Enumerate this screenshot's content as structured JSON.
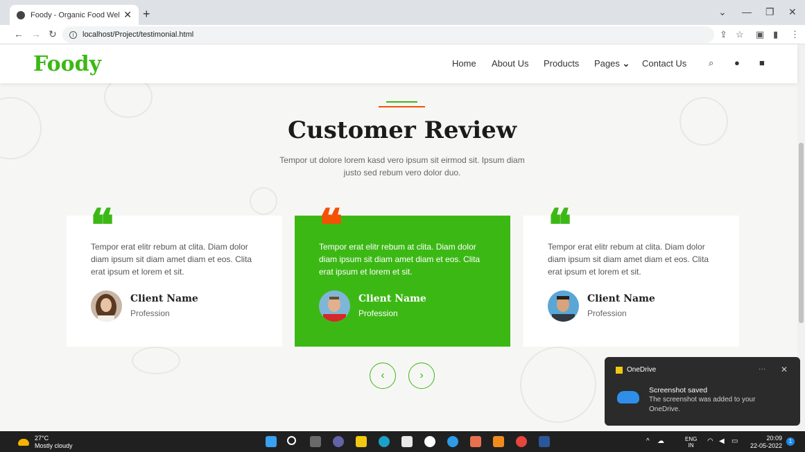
{
  "browser": {
    "tab_title": "Foody - Organic Food Website T",
    "url": "localhost/Project/testimonial.html",
    "new_tab": "+",
    "tab_close": "✕"
  },
  "site": {
    "logo": "Foody",
    "nav": [
      "Home",
      "About Us",
      "Products",
      "Pages",
      "Contact Us"
    ],
    "pages_caret": "⌄"
  },
  "section": {
    "title": "Customer Review",
    "subtitle": "Tempor ut dolore lorem kasd vero ipsum sit eirmod sit. Ipsum diam justo sed rebum vero dolor duo."
  },
  "testimonials": [
    {
      "text": "Tempor erat elitr rebum at clita. Diam dolor diam ipsum sit diam amet diam et eos. Clita erat ipsum et lorem et sit.",
      "name": "Client Name",
      "profession": "Profession"
    },
    {
      "text": "Tempor erat elitr rebum at clita. Diam dolor diam ipsum sit diam amet diam et eos. Clita erat ipsum et lorem et sit.",
      "name": "Client Name",
      "profession": "Profession"
    },
    {
      "text": "Tempor erat elitr rebum at clita. Diam dolor diam ipsum sit diam amet diam et eos. Clita erat ipsum et lorem et sit.",
      "name": "Client Name",
      "profession": "Profession"
    }
  ],
  "carousel": {
    "prev": "‹",
    "next": "›"
  },
  "toast": {
    "app": "OneDrive",
    "title": "Screenshot saved",
    "body": "The screenshot was added to your OneDrive."
  },
  "taskbar": {
    "temp": "27°C",
    "weather": "Mostly cloudy",
    "lang_1": "ENG",
    "lang_2": "IN",
    "time": "20:09",
    "date": "22-05-2022",
    "notifications": "1"
  },
  "colors": {
    "accent_green": "#3cb815",
    "accent_orange": "#f65005"
  }
}
